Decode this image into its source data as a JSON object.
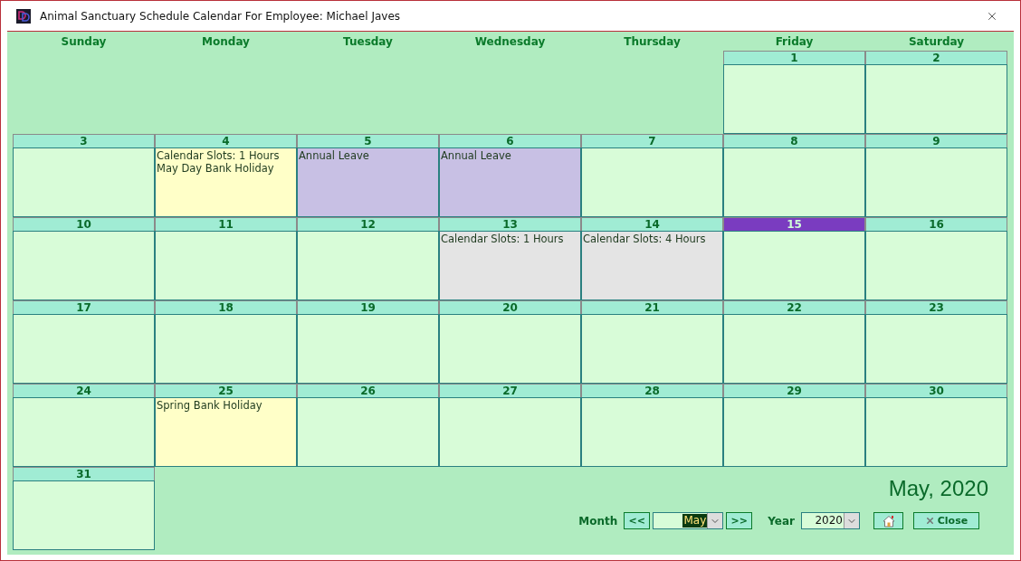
{
  "window": {
    "title": "Animal Sanctuary Schedule Calendar For Employee: Michael Javes"
  },
  "weekdays": [
    "Sunday",
    "Monday",
    "Tuesday",
    "Wednesday",
    "Thursday",
    "Friday",
    "Saturday"
  ],
  "weeks": [
    {
      "days": [
        {
          "day": "1",
          "kind": "normal",
          "today": false
        },
        {
          "day": "2",
          "kind": "normal",
          "today": false
        }
      ]
    },
    {
      "days": [
        {
          "day": "3",
          "kind": "normal",
          "today": false
        },
        {
          "day": "4",
          "kind": "holiday",
          "today": false,
          "entries": [
            "Calendar Slots: 1 Hours",
            "May Day Bank Holiday"
          ]
        },
        {
          "day": "5",
          "kind": "leave",
          "today": false,
          "entries": [
            "Annual Leave"
          ]
        },
        {
          "day": "6",
          "kind": "leave",
          "today": false,
          "entries": [
            "Annual Leave"
          ]
        },
        {
          "day": "7",
          "kind": "normal",
          "today": false
        },
        {
          "day": "8",
          "kind": "normal",
          "today": false
        },
        {
          "day": "9",
          "kind": "normal",
          "today": false
        }
      ]
    },
    {
      "days": [
        {
          "day": "10",
          "kind": "normal",
          "today": false
        },
        {
          "day": "11",
          "kind": "normal",
          "today": false
        },
        {
          "day": "12",
          "kind": "normal",
          "today": false
        },
        {
          "day": "13",
          "kind": "slots",
          "today": false,
          "entries": [
            "Calendar Slots: 1 Hours"
          ]
        },
        {
          "day": "14",
          "kind": "slots",
          "today": false,
          "entries": [
            "Calendar Slots: 4 Hours"
          ]
        },
        {
          "day": "15",
          "kind": "normal",
          "today": true
        },
        {
          "day": "16",
          "kind": "normal",
          "today": false
        }
      ]
    },
    {
      "days": [
        {
          "day": "17",
          "kind": "normal",
          "today": false
        },
        {
          "day": "18",
          "kind": "normal",
          "today": false
        },
        {
          "day": "19",
          "kind": "normal",
          "today": false
        },
        {
          "day": "20",
          "kind": "normal",
          "today": false
        },
        {
          "day": "21",
          "kind": "normal",
          "today": false
        },
        {
          "day": "22",
          "kind": "normal",
          "today": false
        },
        {
          "day": "23",
          "kind": "normal",
          "today": false
        }
      ]
    },
    {
      "days": [
        {
          "day": "24",
          "kind": "normal",
          "today": false
        },
        {
          "day": "25",
          "kind": "holiday",
          "today": false,
          "entries": [
            "Spring Bank Holiday"
          ]
        },
        {
          "day": "26",
          "kind": "normal",
          "today": false
        },
        {
          "day": "27",
          "kind": "normal",
          "today": false
        },
        {
          "day": "28",
          "kind": "normal",
          "today": false
        },
        {
          "day": "29",
          "kind": "normal",
          "today": false
        },
        {
          "day": "30",
          "kind": "normal",
          "today": false
        }
      ]
    },
    {
      "days": [
        {
          "day": "31",
          "kind": "normal",
          "today": false
        }
      ]
    }
  ],
  "footer": {
    "heading": "May, 2020",
    "month_label": "Month",
    "prev_button": "<<",
    "month_select": {
      "value": "May"
    },
    "next_button": ">>",
    "year_label": "Year",
    "year_select": {
      "value": "2020"
    },
    "close_button": "Close"
  }
}
